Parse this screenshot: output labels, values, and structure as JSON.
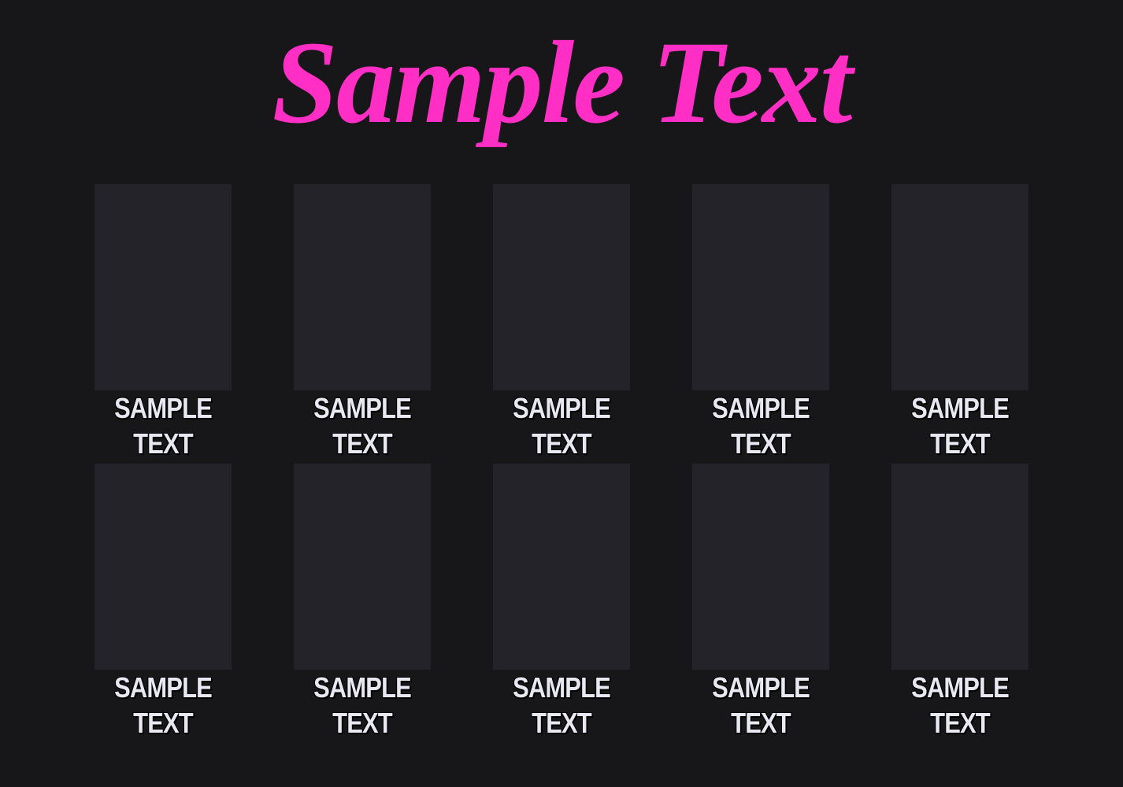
{
  "title": "Sample Text",
  "colors": {
    "background": "#17171a",
    "title": "#ff2ec4",
    "card": "#232329",
    "label": "#e8e8f2"
  },
  "cards": [
    {
      "line1": "SAMPLE",
      "line2": "TEXT"
    },
    {
      "line1": "SAMPLE",
      "line2": "TEXT"
    },
    {
      "line1": "SAMPLE",
      "line2": "TEXT"
    },
    {
      "line1": "SAMPLE",
      "line2": "TEXT"
    },
    {
      "line1": "SAMPLE",
      "line2": "TEXT"
    },
    {
      "line1": "SAMPLE",
      "line2": "TEXT"
    },
    {
      "line1": "SAMPLE",
      "line2": "TEXT"
    },
    {
      "line1": "SAMPLE",
      "line2": "TEXT"
    },
    {
      "line1": "SAMPLE",
      "line2": "TEXT"
    },
    {
      "line1": "SAMPLE",
      "line2": "TEXT"
    }
  ]
}
